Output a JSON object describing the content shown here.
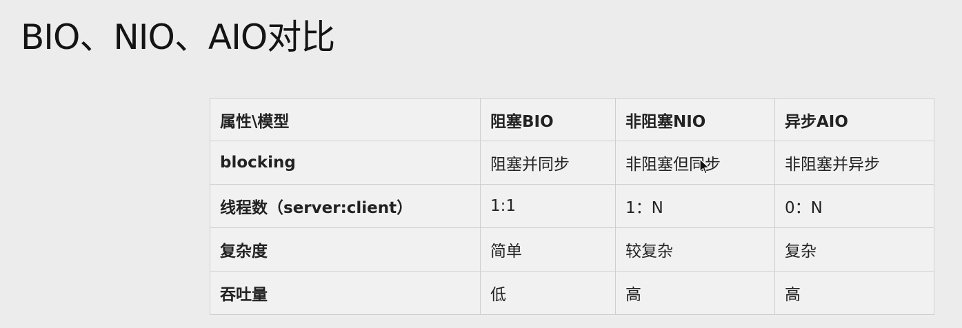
{
  "title": "BIO、NIO、AIO对比",
  "table": {
    "header": [
      "属性\\模型",
      "阻塞BIO",
      "非阻塞NIO",
      "异步AIO"
    ],
    "rows": [
      [
        "blocking",
        "阻塞并同步",
        "非阻塞但同步",
        "非阻塞并异步"
      ],
      [
        "线程数（server:client）",
        "1:1",
        "1：N",
        "0：N"
      ],
      [
        "复杂度",
        "简单",
        "较复杂",
        "复杂"
      ],
      [
        "吞吐量",
        "低",
        "高",
        "高"
      ]
    ]
  },
  "cursor": {
    "icon": "mouse-pointer-icon"
  }
}
